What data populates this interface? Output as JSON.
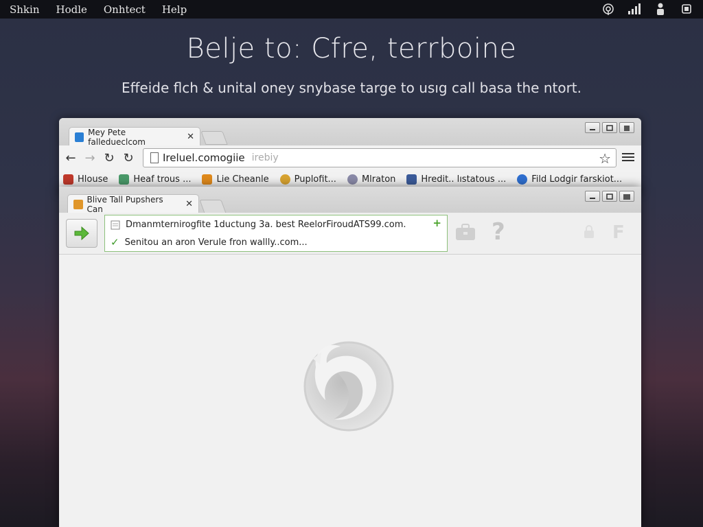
{
  "system_bar": {
    "menu": [
      "Shkin",
      "Hodle",
      "Onhtect",
      "Help"
    ]
  },
  "hero": {
    "title": "Belje to: Cfre, terrboine",
    "subtitle": "Effeide flch & unital oney snybase targe to usıg call basa the ntort."
  },
  "back_window": {
    "tab_title": "Mey Pete falledueclcom",
    "url": "Ireluel.comogiie",
    "url_placeholder": "irebiy",
    "bookmarks": [
      {
        "label": "Hlouse",
        "icon": "home-bookmark-icon",
        "color": "#c0392b"
      },
      {
        "label": "Heaf trous ...",
        "icon": "leaf-bookmark-icon",
        "color": "#4a9a6a"
      },
      {
        "label": "Lie Cheanle",
        "icon": "folder-bookmark-icon",
        "color": "#e08a1c"
      },
      {
        "label": "Puplofit...",
        "icon": "globe-bookmark-icon",
        "color": "#d9a431"
      },
      {
        "label": "Mlraton",
        "icon": "gear-bookmark-icon",
        "color": "#8a8aa8"
      },
      {
        "label": "Hredit.. lıstatous ...",
        "icon": "page-bookmark-icon",
        "color": "#3b5b9a"
      },
      {
        "label": "Fild Lodgir farskiot...",
        "icon": "circle-bookmark-icon",
        "color": "#2f6fd0"
      }
    ]
  },
  "front_window": {
    "tab_title": "Blive Tall Pupshers Can",
    "suggestion_line1": "Dmanmternirogfite 1ductung 3a. best ReelorFiroudATS99.com.",
    "suggestion_line2": "Senitou an aron Verule fron wallly..com...",
    "faint_question": "?",
    "faint_f": "F"
  },
  "colors": {
    "accent_green": "#4aa32b",
    "background_top": "#2b3044",
    "background_bottom": "#4a2f3e"
  }
}
